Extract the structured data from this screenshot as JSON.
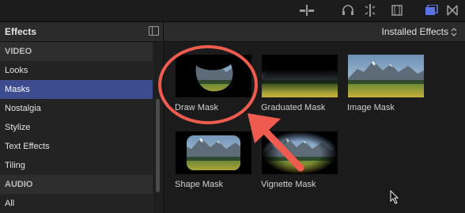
{
  "toolbar": {
    "icons": [
      "audio-skimming-icon",
      "headphones-icon",
      "clip-skimming-icon",
      "filmstrip-icon",
      "browser-toggle-icon",
      "transitions-icon"
    ]
  },
  "sidebar": {
    "title": "Effects",
    "rows": [
      {
        "label": "VIDEO",
        "kind": "section"
      },
      {
        "label": "Looks",
        "kind": "item"
      },
      {
        "label": "Masks",
        "kind": "item",
        "selected": true
      },
      {
        "label": "Nostalgia",
        "kind": "item"
      },
      {
        "label": "Stylize",
        "kind": "item"
      },
      {
        "label": "Text Effects",
        "kind": "item"
      },
      {
        "label": "Tiling",
        "kind": "item"
      },
      {
        "label": "AUDIO",
        "kind": "section"
      },
      {
        "label": "All",
        "kind": "item"
      }
    ]
  },
  "browser": {
    "filter_label": "Installed Effects",
    "effects": [
      {
        "name": "Draw Mask",
        "mask": "blob"
      },
      {
        "name": "Graduated Mask",
        "mask": "gradient"
      },
      {
        "name": "Image Mask",
        "mask": "none"
      },
      {
        "name": "Shape Mask",
        "mask": "rounded-rect"
      },
      {
        "name": "Vignette Mask",
        "mask": "ellipse"
      }
    ]
  },
  "colors": {
    "selection": "#3d4b8f",
    "annotation": "#ef5b4f",
    "accent_icon": "#5b73e6"
  }
}
